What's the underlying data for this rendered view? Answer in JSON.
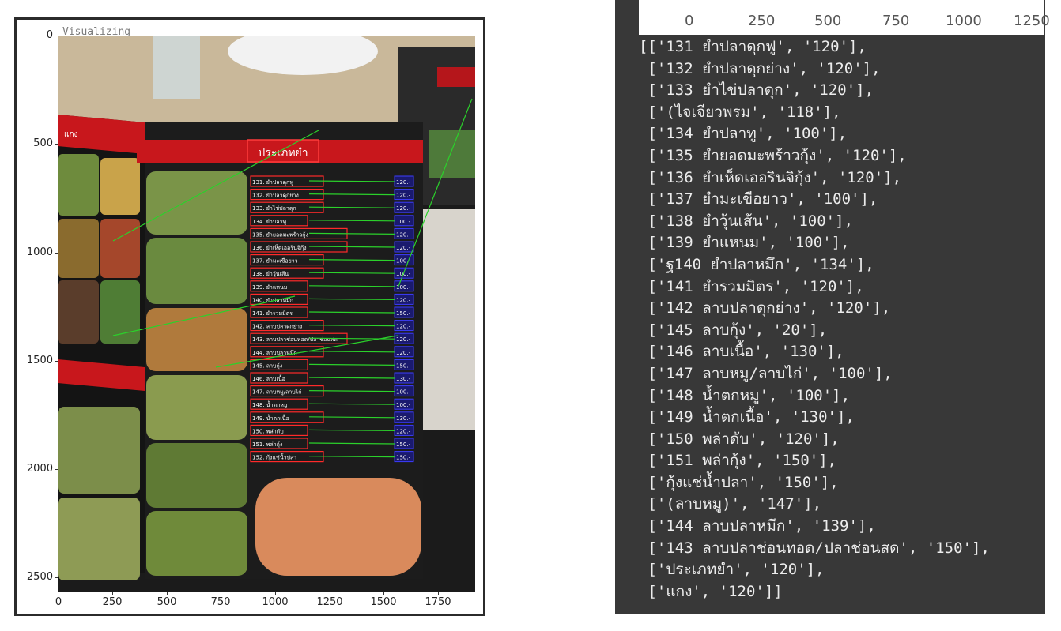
{
  "figure": {
    "title": "Visualizing",
    "y_ticks": [
      "0",
      "500",
      "1000",
      "1500",
      "2000",
      "2500"
    ],
    "x_ticks": [
      "0",
      "250",
      "500",
      "750",
      "1000",
      "1250",
      "1500",
      "1750"
    ],
    "menu_heading": "ประเภทยำ",
    "side_tab": "แกง",
    "image_menu_items": [
      {
        "label": "131. ยำปลาดุกฟู",
        "price": "120.-"
      },
      {
        "label": "132. ยำปลาดุกย่าง",
        "price": "120.-"
      },
      {
        "label": "133. ยำไข่ปลาดุก",
        "price": "120.-"
      },
      {
        "label": "134. ยำปลาทู",
        "price": "100.-"
      },
      {
        "label": "135. ยำยอดมะพร้าวกุ้ง",
        "price": "120.-"
      },
      {
        "label": "136. ยำเห็ดเออรินจิกุ้ง",
        "price": "120.-"
      },
      {
        "label": "137. ยำมะเขือยาว",
        "price": "100.-"
      },
      {
        "label": "138. ยำวุ้นเส้น",
        "price": "100.-"
      },
      {
        "label": "139. ยำแหนม",
        "price": "100.-"
      },
      {
        "label": "140. ยำปลาหมึก",
        "price": "120.-"
      },
      {
        "label": "141. ยำรวมมิตร",
        "price": "150.-"
      },
      {
        "label": "142. ลาบปลาดุกย่าง",
        "price": "120.-"
      },
      {
        "label": "143. ลาบปลาช่อนทอด/ปลาช่อนสด",
        "price": "120.-"
      },
      {
        "label": "144. ลาบปลาหมึก",
        "price": "120.-"
      },
      {
        "label": "145. ลาบกุ้ง",
        "price": "150.-"
      },
      {
        "label": "146. ลาบเนื้อ",
        "price": "130.-"
      },
      {
        "label": "147. ลาบหมู/ลาบไก่",
        "price": "100.-"
      },
      {
        "label": "148. น้ำตกหมู",
        "price": "100.-"
      },
      {
        "label": "149. น้ำตกเนื้อ",
        "price": "130.-"
      },
      {
        "label": "150. พล่าดับ",
        "price": "120.-"
      },
      {
        "label": "151. พล่ากุ้ง",
        "price": "150.-"
      },
      {
        "label": "152. กุ้งแช่น้ำปลา",
        "price": "150.-"
      }
    ]
  },
  "output": {
    "axis_ticks": [
      "0",
      "250",
      "500",
      "750",
      "1000",
      "1250"
    ],
    "lines": [
      "[['131 ยำปลาดุกฟู', '120'],",
      " ['132 ยำปลาดุกย่าง', '120'],",
      " ['133 ยำไข่ปลาดุก', '120'],",
      " ['(ไจเจียวพรม', '118'],",
      " ['134 ยำปลาทู', '100'],",
      " ['135 ยำยอดมะพร้าวกุ้ง', '120'],",
      " ['136 ยำเห็ดเออรินจิกุ้ง', '120'],",
      " ['137 ยำมะเขือยาว', '100'],",
      " ['138 ยำวุ้นเส้น', '100'],",
      " ['139 ยำแหนม', '100'],",
      " ['ฐ140 ยำปลาหมึก', '134'],",
      " ['141 ยำรวมมิตร', '120'],",
      " ['142 ลาบปลาดุกย่าง', '120'],",
      " ['145 ลาบกุ้ง', '20'],",
      " ['146 ลาบเนื้อ', '130'],",
      " ['147 ลาบหมู/ลาบไก่', '100'],",
      " ['148 น้ำตกหมู', '100'],",
      " ['149 น้ำตกเนื้อ', '130'],",
      " ['150 พล่าดับ', '120'],",
      " ['151 พล่ากุ้ง', '150'],",
      " ['กุ้งแช่น้ำปลา', '150'],",
      " ['(ลาบหมู)', '147'],",
      " ['144 ลาบปลาหมึก', '139'],",
      " ['143 ลาบปลาช่อนทอด/ปลาช่อนสด', '150'],",
      " ['ประเภทยำ', '120'],",
      " ['แกง', '120']]"
    ]
  }
}
